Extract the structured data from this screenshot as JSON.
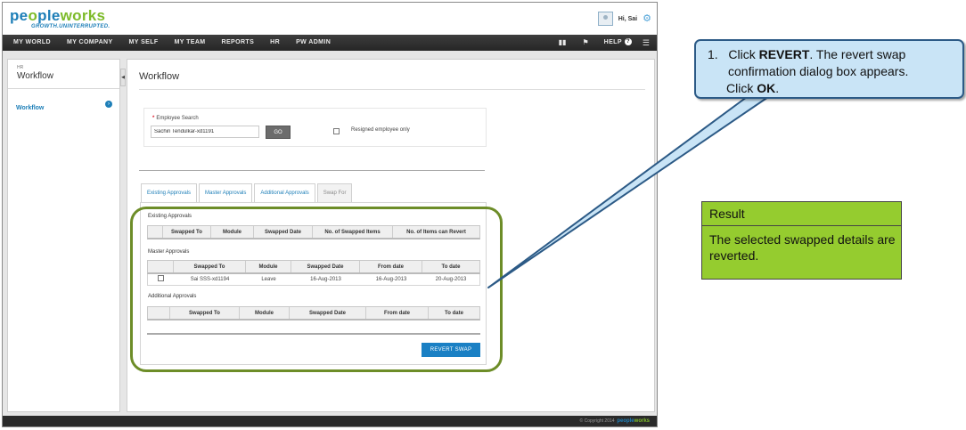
{
  "app": {
    "logo": {
      "part1": "pe",
      "part2": "o",
      "part3": "ple",
      "part4": "w",
      "part5": "o",
      "part6": "rks",
      "tagline": "GROWTH.UNINTERRUPTED."
    },
    "greeting": "Hi, Sai",
    "nav": {
      "items": [
        "MY WORLD",
        "MY COMPANY",
        "MY SELF",
        "MY TEAM",
        "REPORTS",
        "HR",
        "PW ADMIN"
      ],
      "help_label": "HELP",
      "icons": [
        "book-icon",
        "flag-icon",
        "help-icon",
        "menu-icon"
      ]
    },
    "sidebar": {
      "section": "HR",
      "title": "Workflow",
      "items": [
        {
          "label": "Workflow",
          "icon": "arrow-right-icon"
        }
      ]
    },
    "main": {
      "title": "Workflow",
      "search": {
        "label": "Employee Search",
        "value": "Sachin Tendulkar-xd1191",
        "go_label": "GO",
        "resigned_label": "Resigned employee only"
      },
      "tabs": [
        {
          "label": "Existing Approvals",
          "active": false
        },
        {
          "label": "Master Approvals",
          "active": false
        },
        {
          "label": "Additional Approvals",
          "active": false
        },
        {
          "label": "Swap For",
          "active": true
        }
      ],
      "existing": {
        "title": "Existing Approvals",
        "columns": [
          "",
          "Swapped To",
          "Module",
          "Swapped Date",
          "No. of Swapped Items",
          "No. of Items can Revert"
        ]
      },
      "master": {
        "title": "Master Approvals",
        "columns": [
          "",
          "Swapped To",
          "Module",
          "Swapped Date",
          "From date",
          "To date"
        ],
        "rows": [
          {
            "swapped_to": "Sai SSS-xd1194",
            "module": "Leave",
            "swapped_date": "16-Aug-2013",
            "from_date": "16-Aug-2013",
            "to_date": "20-Aug-2013"
          }
        ]
      },
      "additional": {
        "title": "Additional Approvals",
        "columns": [
          "",
          "Swapped To",
          "Module",
          "Swapped Date",
          "From date",
          "To date"
        ]
      },
      "revert_label": "REVERT SWAP"
    },
    "footer": {
      "copyright": "© Copyright 2014",
      "brand_a": "people",
      "brand_b": "works"
    }
  },
  "annotation": {
    "callout": {
      "number": "1.",
      "pre": "Click ",
      "bold1": "REVERT",
      "mid": ". The revert swap",
      "line2": "confirmation dialog box appears.",
      "line3_pre": "Click ",
      "bold2": "OK",
      "line3_post": "."
    },
    "result": {
      "heading": "Result",
      "body": "The selected swapped details are reverted."
    }
  },
  "colors": {
    "brand_blue": "#1e7fb8",
    "brand_green": "#7dbb2a",
    "highlight_ring": "#6d8d28",
    "callout_fill": "#c9e4f6",
    "callout_border": "#2c5a86",
    "result_fill": "#95cc2f"
  }
}
